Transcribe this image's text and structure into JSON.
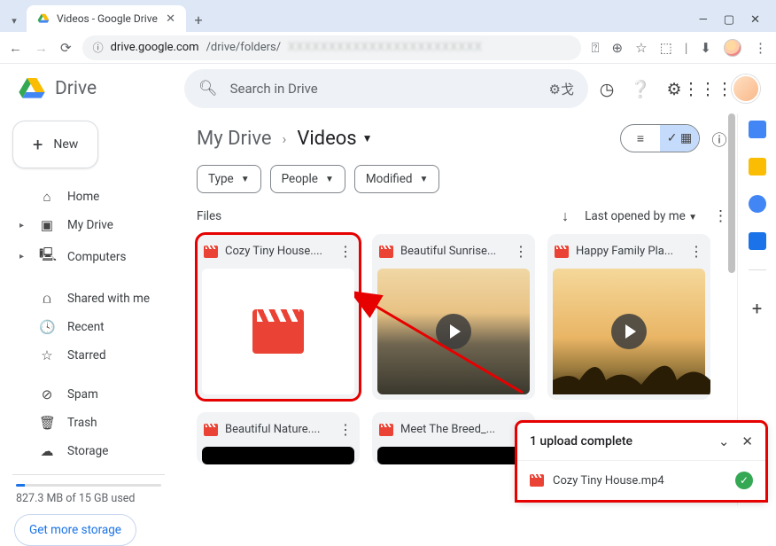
{
  "browser": {
    "tab_title": "Videos - Google Drive",
    "url_host": "drive.google.com",
    "url_path": "/drive/folders/"
  },
  "app": {
    "name": "Drive",
    "search_placeholder": "Search in Drive"
  },
  "sidebar": {
    "new_label": "New",
    "items": [
      {
        "label": "Home"
      },
      {
        "label": "My Drive"
      },
      {
        "label": "Computers"
      },
      {
        "label": "Shared with me"
      },
      {
        "label": "Recent"
      },
      {
        "label": "Starred"
      },
      {
        "label": "Spam"
      },
      {
        "label": "Trash"
      },
      {
        "label": "Storage"
      }
    ],
    "storage_text": "827.3 MB of 15 GB used",
    "get_more_label": "Get more storage"
  },
  "breadcrumb": {
    "root": "My Drive",
    "current": "Videos"
  },
  "filters": {
    "type": "Type",
    "people": "People",
    "modified": "Modified"
  },
  "files_section": {
    "heading": "Files",
    "sort_label": "Last opened by me"
  },
  "files": [
    {
      "name": "Cozy Tiny House...."
    },
    {
      "name": "Beautiful Sunrise..."
    },
    {
      "name": "Happy Family Pla..."
    },
    {
      "name": "Beautiful Nature...."
    },
    {
      "name": "Meet The Breed_..."
    }
  ],
  "upload_toast": {
    "title": "1 upload complete",
    "file": "Cozy Tiny House.mp4"
  }
}
